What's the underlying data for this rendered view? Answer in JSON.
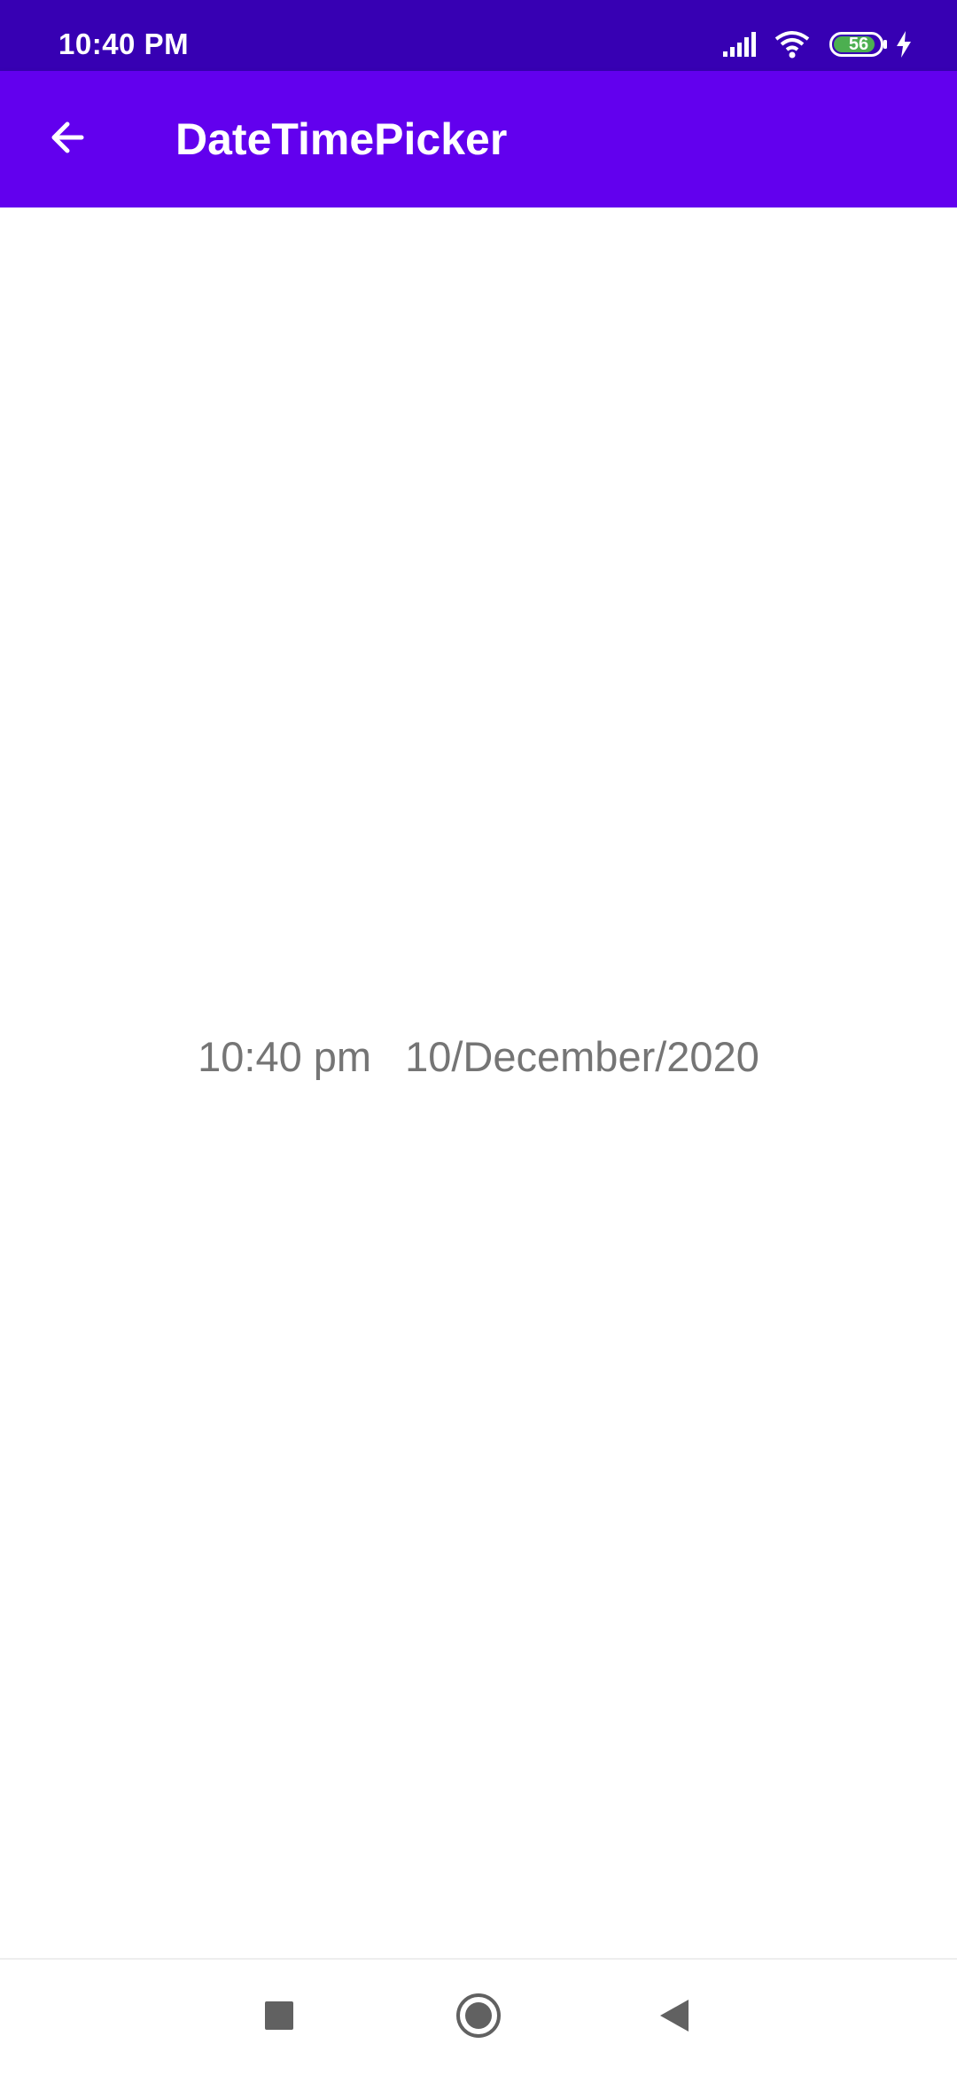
{
  "status_bar": {
    "time": "10:40 PM",
    "battery_level": "56",
    "icons": [
      "signal-icon",
      "wifi-icon",
      "battery-icon",
      "charging-icon"
    ],
    "background_color": "#3700b3"
  },
  "app_bar": {
    "title": "DateTimePicker",
    "back_icon": "arrow-back-icon",
    "background_color": "#6200ee"
  },
  "content": {
    "time_text": "10:40 pm",
    "date_text": "10/December/2020",
    "text_color": "#757575"
  },
  "nav_bar": {
    "icons": [
      "recents-square-icon",
      "home-circle-icon",
      "back-triangle-icon"
    ]
  }
}
